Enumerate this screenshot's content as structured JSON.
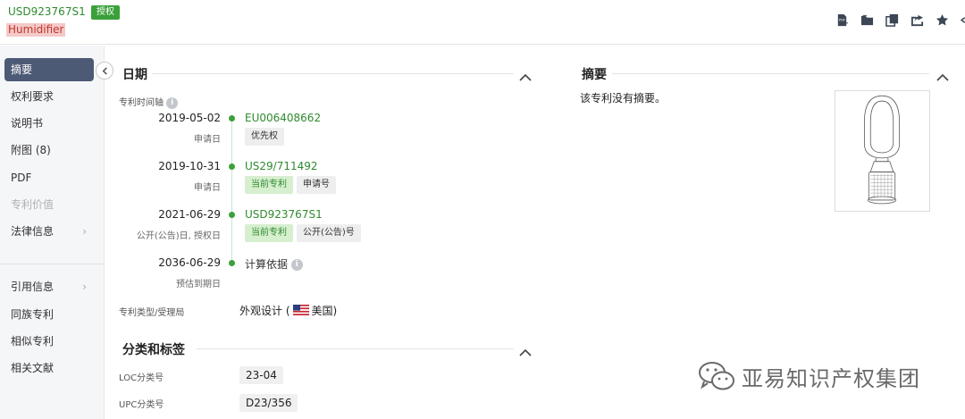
{
  "header": {
    "patent_number": "USD923767S1",
    "status_badge": "授权",
    "title": "Humidifier",
    "tools": [
      "pdf-download-icon",
      "folder-icon",
      "copy-icon",
      "share-icon",
      "star-icon"
    ]
  },
  "sidebar": {
    "items": [
      {
        "label": "摘要",
        "state": "active"
      },
      {
        "label": "权利要求"
      },
      {
        "label": "说明书"
      },
      {
        "label": "附图 (8)"
      },
      {
        "label": "PDF"
      },
      {
        "label": "专利价值",
        "state": "disabled"
      },
      {
        "label": "法律信息",
        "has_arrow": true
      },
      {
        "label": "引用信息",
        "has_arrow": true
      },
      {
        "label": "同族专利"
      },
      {
        "label": "相似专利"
      },
      {
        "label": "相关文献"
      }
    ]
  },
  "dates_section": {
    "title": "日期",
    "timeline_label": "专利时间轴",
    "entries": [
      {
        "date": "2019-05-02",
        "desc": "申请日",
        "number": "EU006408662",
        "tags": [
          "优先权"
        ]
      },
      {
        "date": "2019-10-31",
        "desc": "申请日",
        "number": "US29/711492",
        "tags": [
          "当前专利",
          "申请号"
        ]
      },
      {
        "date": "2021-06-29",
        "desc": "公开(公告)日, 授权日",
        "number": "USD923767S1",
        "tags": [
          "当前专利",
          "公开(公告)号"
        ]
      },
      {
        "date": "2036-06-29",
        "desc": "预估到期日",
        "number": "计算依据",
        "tags": []
      }
    ],
    "type_label": "专利类型/受理局",
    "type_value_prefix": "外观设计 (",
    "type_value_country": "美国)"
  },
  "classification_section": {
    "title": "分类和标签",
    "loc_label": "LOC分类号",
    "loc_value": "23-04",
    "upc_label": "UPC分类号",
    "upc_value": "D23/356"
  },
  "abstract_section": {
    "title": "摘要",
    "text": "该专利没有摘要。"
  },
  "watermark": {
    "text": "亚易知识产权集团"
  },
  "colors": {
    "accent_green": "#3aa13a",
    "sidebar_active": "#4d5a75",
    "title_highlight": "#f4c9c9"
  }
}
